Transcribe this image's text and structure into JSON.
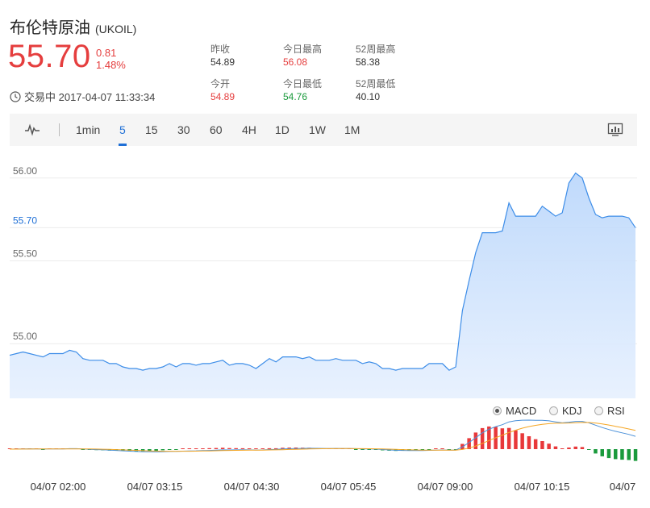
{
  "header": {
    "name": "布伦特原油",
    "code": "(UKOIL)",
    "price": "55.70",
    "change": "0.81",
    "change_pct": "1.48%",
    "status_time": "交易中 2017-04-07 11:33:34"
  },
  "stats": [
    {
      "label": "昨收",
      "value": "54.89",
      "color": "#333333"
    },
    {
      "label": "今日最高",
      "value": "56.08",
      "color": "#e53e3e"
    },
    {
      "label": "52周最高",
      "value": "58.38",
      "color": "#333333"
    },
    {
      "label": "今开",
      "value": "54.89",
      "color": "#e53e3e"
    },
    {
      "label": "今日最低",
      "value": "54.76",
      "color": "#1a9a3c"
    },
    {
      "label": "52周最低",
      "value": "40.10",
      "color": "#333333"
    }
  ],
  "toolbar": {
    "items": [
      "1min",
      "5",
      "15",
      "30",
      "60",
      "4H",
      "1D",
      "1W",
      "1M"
    ],
    "active": "5"
  },
  "indicators": [
    {
      "label": "MACD",
      "selected": true
    },
    {
      "label": "KDJ",
      "selected": false
    },
    {
      "label": "RSI",
      "selected": false
    }
  ],
  "chart_data": {
    "type": "area",
    "y_ticks": [
      "56.00",
      "55.70",
      "55.50",
      "55.00"
    ],
    "y_tick_values": [
      56.0,
      55.7,
      55.5,
      55.0
    ],
    "current_price_label": "55.70",
    "x_tick_labels": [
      "04/07 02:00",
      "04/07 03:15",
      "04/07 04:30",
      "04/07 05:45",
      "04/07 09:00",
      "04/07 10:15",
      "04/07"
    ],
    "values": [
      54.93,
      54.94,
      54.95,
      54.94,
      54.93,
      54.92,
      54.94,
      54.94,
      54.94,
      54.96,
      54.95,
      54.91,
      54.9,
      54.9,
      54.9,
      54.88,
      54.88,
      54.86,
      54.85,
      54.85,
      54.84,
      54.85,
      54.85,
      54.86,
      54.88,
      54.86,
      54.88,
      54.88,
      54.87,
      54.88,
      54.88,
      54.89,
      54.9,
      54.87,
      54.88,
      54.88,
      54.87,
      54.85,
      54.88,
      54.91,
      54.89,
      54.92,
      54.92,
      54.92,
      54.91,
      54.92,
      54.9,
      54.9,
      54.9,
      54.91,
      54.9,
      54.9,
      54.9,
      54.88,
      54.89,
      54.88,
      54.85,
      54.85,
      54.84,
      54.85,
      54.85,
      54.85,
      54.85,
      54.88,
      54.88,
      54.88,
      54.84,
      54.86,
      55.2,
      55.38,
      55.55,
      55.67,
      55.67,
      55.67,
      55.68,
      55.85,
      55.77,
      55.77,
      55.77,
      55.77,
      55.83,
      55.8,
      55.77,
      55.79,
      55.97,
      56.03,
      56.0,
      55.88,
      55.78,
      55.76,
      55.77,
      55.77,
      55.77,
      55.76,
      55.7
    ],
    "series": [
      {
        "name": "MACD",
        "type": "bar"
      },
      {
        "name": "DIF",
        "type": "line",
        "color": "#4a90d9"
      },
      {
        "name": "DEA",
        "type": "line",
        "color": "#f5a623"
      }
    ]
  }
}
